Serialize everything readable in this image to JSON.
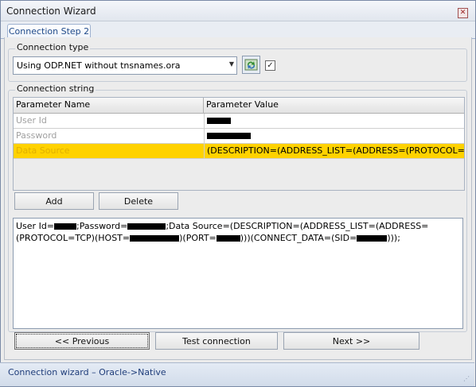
{
  "window": {
    "title": "Connection Wizard",
    "close_glyph": "✕"
  },
  "tabs": [
    {
      "label": "Connection Step 2"
    }
  ],
  "connection_type": {
    "group_label": "Connection type",
    "selected": "Using ODP.NET without tnsnames.ora",
    "dropdown_arrow": "▼",
    "checkbox_checked": "✓"
  },
  "connection_string_group": {
    "group_label": "Connection string",
    "columns": [
      "Parameter Name",
      "Parameter Value"
    ],
    "rows": [
      {
        "name": "User Id",
        "value": ""
      },
      {
        "name": "Password",
        "value": ""
      },
      {
        "name": "Data Source",
        "value": "(DESCRIPTION=(ADDRESS_LIST=(ADDRESS=(PROTOCOL=..."
      }
    ]
  },
  "buttons": {
    "add": "Add",
    "delete": "Delete",
    "previous": "<< Previous",
    "test": "Test connection",
    "next": "Next >>"
  },
  "conn_text": {
    "p1": "User Id=",
    "p2": ";Password=",
    "p3": ";Data Source=(DESCRIPTION=(ADDRESS_LIST=(ADDRESS=",
    "p4": "(PROTOCOL=TCP)(HOST=",
    "p5": ")(PORT=",
    "p6": ")))(CONNECT_DATA=(SID=",
    "p7": ")));"
  },
  "status": {
    "text": "Connection  wizard  –  Oracle->Native",
    "grip": "⋰"
  },
  "colors": {
    "selected_row": "#ffd200",
    "status_text": "#1f3d7a",
    "tab_text": "#1f4a8a"
  }
}
